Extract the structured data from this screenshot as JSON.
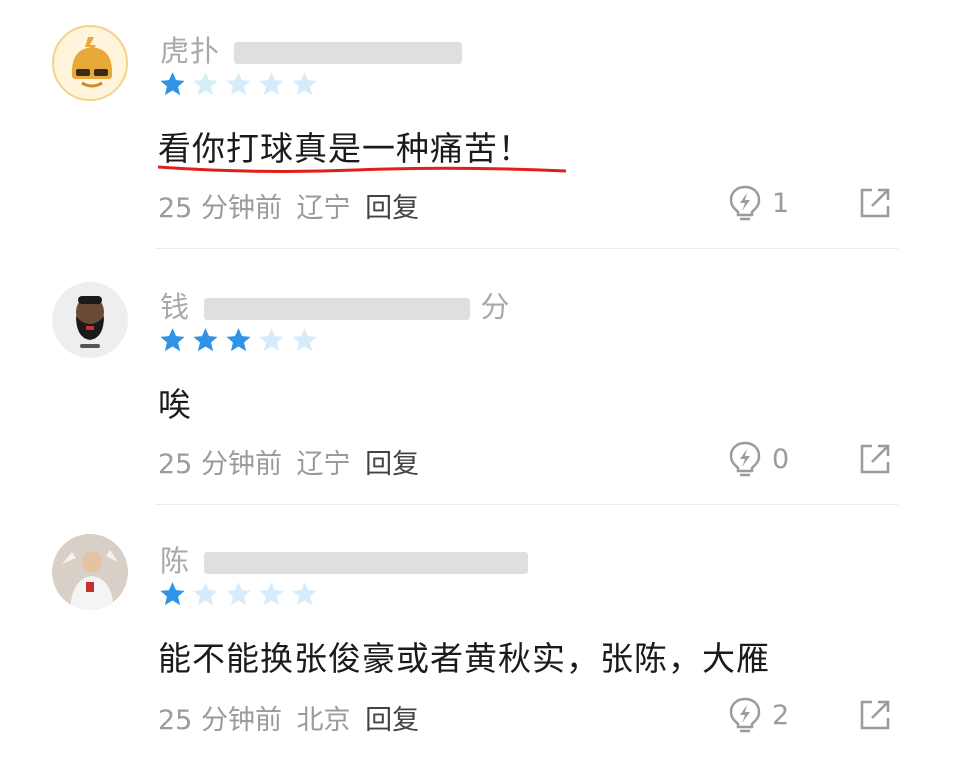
{
  "comments": [
    {
      "username": "虎扑",
      "rating": 1,
      "text": "看你打球真是一种痛苦！",
      "time": "25 分钟前",
      "location": "辽宁",
      "reply_label": "回复",
      "likes": "1"
    },
    {
      "username": "钱",
      "username_suffix": "分",
      "rating": 3,
      "text": "唉",
      "time": "25 分钟前",
      "location": "辽宁",
      "reply_label": "回复",
      "likes": "0"
    },
    {
      "username": "陈",
      "rating": 1,
      "text": "能不能换张俊豪或者黄秋实，张陈，大雁",
      "time": "25 分钟前",
      "location": "北京",
      "reply_label": "回复",
      "likes": "2"
    }
  ],
  "colors": {
    "star_filled": "#2f93e6",
    "star_empty": "#d6ecfb",
    "underline": "#e0201a",
    "meta_text": "#9b9b9b"
  },
  "icons": [
    "avatar",
    "star-icon",
    "lightbulb-like-icon",
    "share-icon"
  ]
}
